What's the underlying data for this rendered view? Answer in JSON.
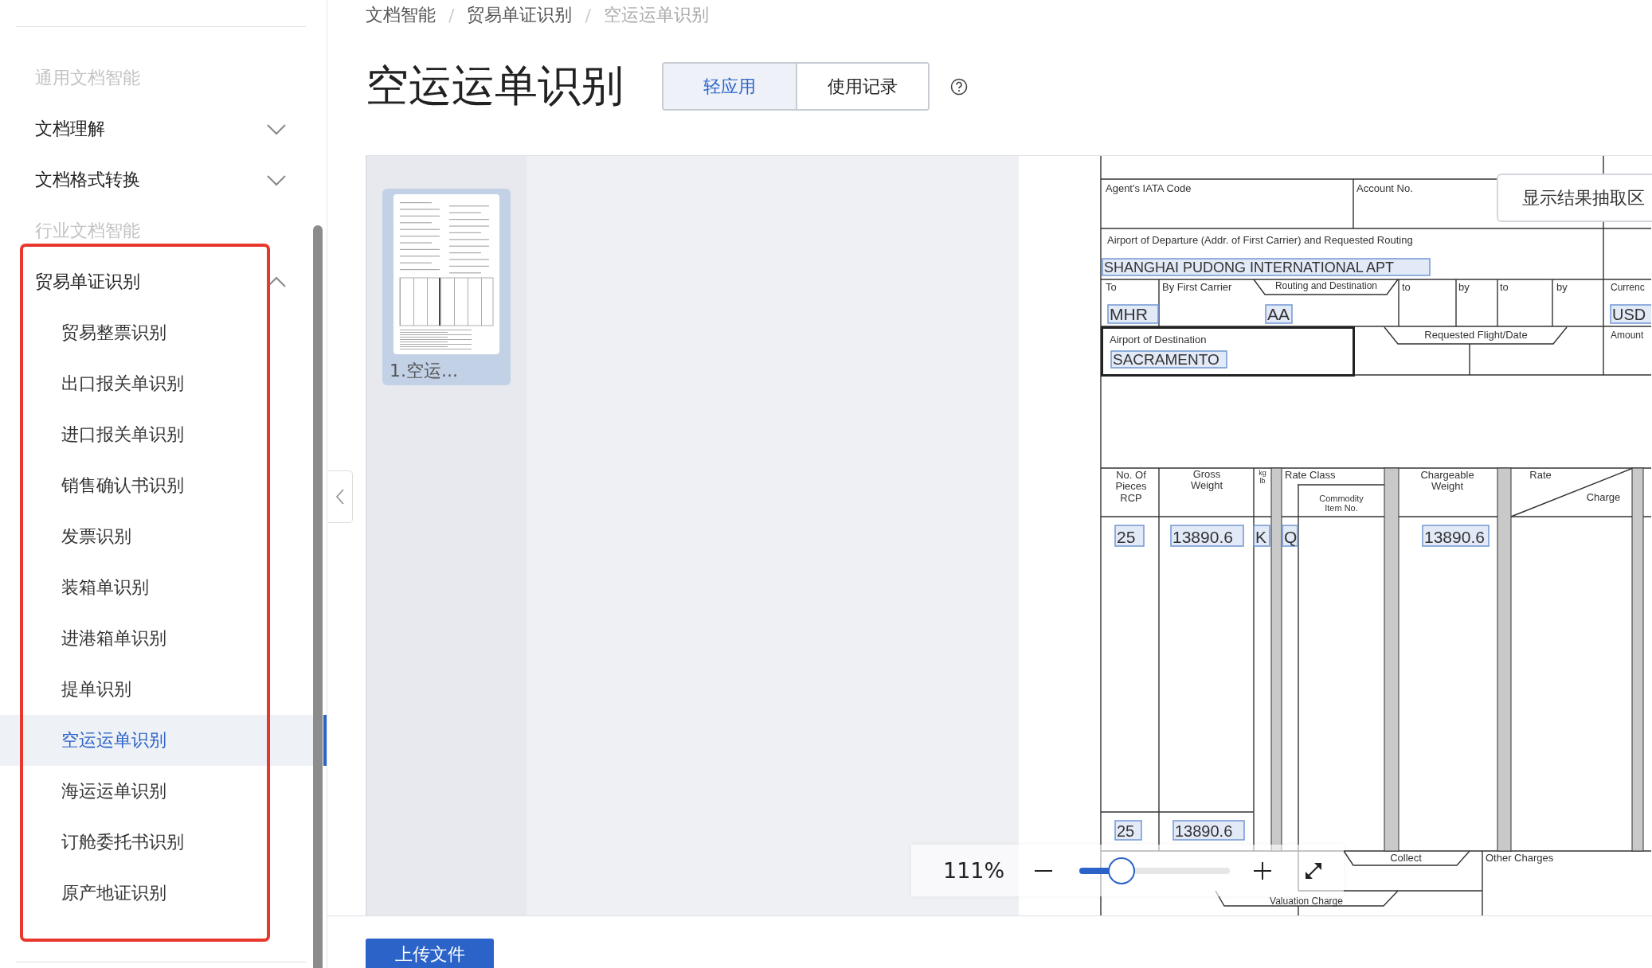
{
  "sidebar": {
    "items": [
      {
        "label": "通用文档智能",
        "kind": "group"
      },
      {
        "label": "文档理解",
        "kind": "menu",
        "expanded": false
      },
      {
        "label": "文档格式转换",
        "kind": "menu",
        "expanded": false
      },
      {
        "label": "行业文档智能",
        "kind": "group"
      },
      {
        "label": "贸易单证识别",
        "kind": "menu",
        "expanded": true,
        "children": [
          {
            "label": "贸易整票识别",
            "selected": false
          },
          {
            "label": "出口报关单识别",
            "selected": false
          },
          {
            "label": "进口报关单识别",
            "selected": false
          },
          {
            "label": "销售确认书识别",
            "selected": false
          },
          {
            "label": "发票识别",
            "selected": false
          },
          {
            "label": "装箱单识别",
            "selected": false
          },
          {
            "label": "进港箱单识别",
            "selected": false
          },
          {
            "label": "提单识别",
            "selected": false
          },
          {
            "label": "空运运单识别",
            "selected": true
          },
          {
            "label": "海运运单识别",
            "selected": false
          },
          {
            "label": "订舱委托书识别",
            "selected": false
          },
          {
            "label": "原产地证识别",
            "selected": false
          }
        ]
      }
    ]
  },
  "breadcrumb": {
    "separator": "/",
    "items": [
      "文档智能",
      "贸易单证识别",
      "空运运单识别"
    ]
  },
  "page_title": "空运运单识别",
  "tabs": [
    {
      "label": "轻应用",
      "selected": true
    },
    {
      "label": "使用记录",
      "selected": false
    }
  ],
  "thumbnails": [
    {
      "caption": "1.空运...",
      "selected": true
    }
  ],
  "document": {
    "labels": [
      "Agent's IATA Code",
      "Account No.",
      "Airport of Departure (Addr. of First Carrier) and Requested Routing",
      "To",
      "By First Carrier",
      "Routing and Destination",
      "to",
      "by",
      "to",
      "by",
      "Currenc",
      "Airport of Destination",
      "Requested Flight/Date",
      "Amount",
      "No. Of\nPieces\nRCP",
      "Gross\nWeight",
      "kg\nlb",
      "Rate Class",
      "Commodity\nItem No.",
      "Chargeable\nWeight",
      "Rate",
      "Charge",
      "Collect",
      "Other Charges",
      "Valuation Charge"
    ],
    "values": [
      "SHANGHAI PUDONG INTERNATIONAL APT",
      "MHR",
      "AA",
      "USD",
      "SACRAMENTO",
      "25",
      "13890.6",
      "K",
      "Q",
      "13890.6",
      "25",
      "13890.6"
    ]
  },
  "result_panel_button": "显示结果抽取区",
  "zoom": {
    "reading": "111%",
    "level": 0.28
  },
  "upload_button": "上传文件"
}
